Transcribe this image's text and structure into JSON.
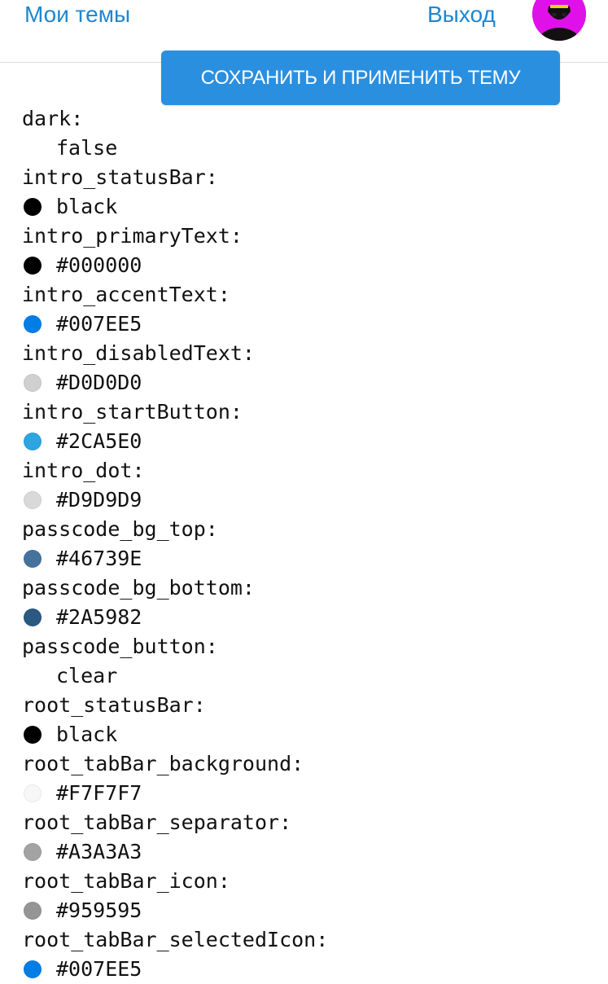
{
  "header": {
    "my_themes_label": "Мои темы",
    "logout_label": "Выход",
    "save_button_label": "СОХРАНИТЬ И ПРИМЕНИТЬ ТЕМУ"
  },
  "theme_entries": [
    {
      "key": "dark:",
      "value": "false",
      "color": null
    },
    {
      "key": "intro_statusBar:",
      "value": "black",
      "color": "#000000"
    },
    {
      "key": "intro_primaryText:",
      "value": "#000000",
      "color": "#000000"
    },
    {
      "key": "intro_accentText:",
      "value": "#007EE5",
      "color": "#007EE5"
    },
    {
      "key": "intro_disabledText:",
      "value": "#D0D0D0",
      "color": "#D0D0D0"
    },
    {
      "key": "intro_startButton:",
      "value": "#2CA5E0",
      "color": "#2CA5E0"
    },
    {
      "key": "intro_dot:",
      "value": "#D9D9D9",
      "color": "#D9D9D9"
    },
    {
      "key": "passcode_bg_top:",
      "value": "#46739E",
      "color": "#46739E"
    },
    {
      "key": "passcode_bg_bottom:",
      "value": "#2A5982",
      "color": "#2A5982"
    },
    {
      "key": "passcode_button:",
      "value": "clear",
      "color": null
    },
    {
      "key": "root_statusBar:",
      "value": "black",
      "color": "#000000"
    },
    {
      "key": "root_tabBar_background:",
      "value": "#F7F7F7",
      "color": "#F7F7F7"
    },
    {
      "key": "root_tabBar_separator:",
      "value": "#A3A3A3",
      "color": "#A3A3A3"
    },
    {
      "key": "root_tabBar_icon:",
      "value": "#959595",
      "color": "#959595"
    },
    {
      "key": "root_tabBar_selectedIcon:",
      "value": "#007EE5",
      "color": "#007EE5"
    }
  ]
}
